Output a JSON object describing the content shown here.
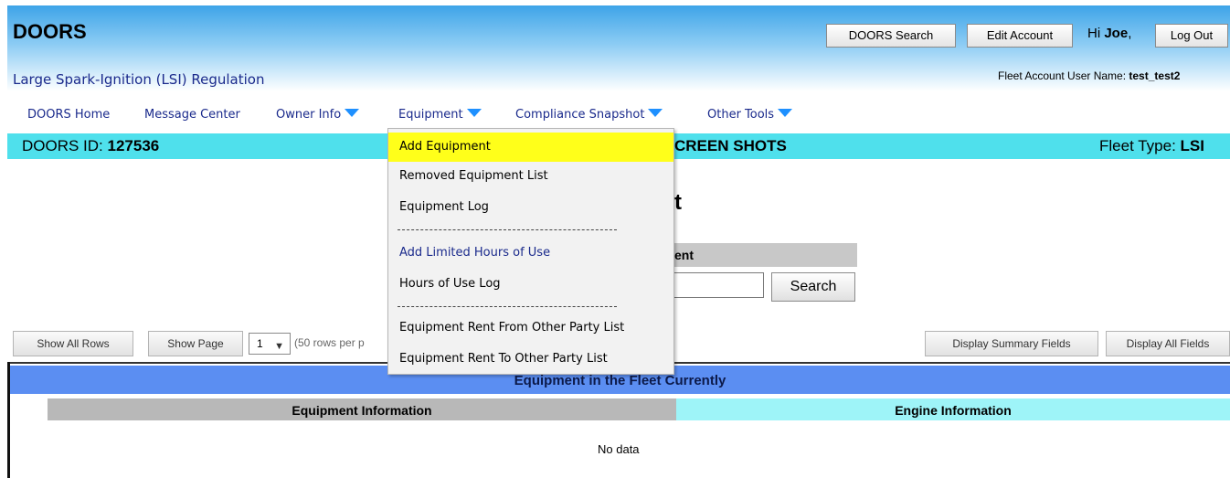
{
  "header": {
    "brand": "DOORS",
    "subtitle": "Large Spark-Ignition (LSI) Regulation",
    "buttons": {
      "search": "DOORS Search",
      "edit_account": "Edit Account",
      "logout": "Log Out"
    },
    "greeting_prefix": "Hi ",
    "user_first_name": "Joe",
    "greeting_suffix": ",",
    "fleet_user_label": "Fleet Account User Name: ",
    "fleet_user_value": "test_test2"
  },
  "nav": {
    "items": [
      "DOORS Home",
      "Message Center",
      "Owner Info",
      "Equipment",
      "Compliance Snapshot",
      "Other Tools"
    ]
  },
  "info_bar": {
    "id_label": "DOORS ID: ",
    "id_value": "127536",
    "fleet_name_fragment": "CREEN SHOTS",
    "fleet_type_label": "Fleet Type: ",
    "fleet_type_value": "LSI"
  },
  "main": {
    "title_fragment": "t",
    "search_section_fragment": "ent",
    "search_button": "Search"
  },
  "grid_controls": {
    "show_all_rows": "Show All Rows",
    "show_page": "Show Page",
    "page_value": "1",
    "rows_per_page_fragment": "(50 rows per p",
    "display_summary": "Display Summary Fields",
    "display_all": "Display All Fields"
  },
  "table": {
    "title": "Equipment in the Fleet Currently",
    "equipment_header": "Equipment Information",
    "engine_header": "Engine Information",
    "empty_text": "No data"
  },
  "equipment_menu": {
    "items": [
      "Add Equipment",
      "Removed Equipment List",
      "Equipment Log",
      "Add Limited Hours of Use",
      "Hours of Use Log",
      "Equipment Rent From Other Party List",
      "Equipment Rent To Other Party List"
    ],
    "highlight_color": "#ffff1a"
  },
  "colors": {
    "cyan_bar": "#4fe0ec",
    "fleet_bar": "#5b8ef2",
    "nav_text": "#1a2a8c",
    "arrow": "#1e90ff"
  }
}
